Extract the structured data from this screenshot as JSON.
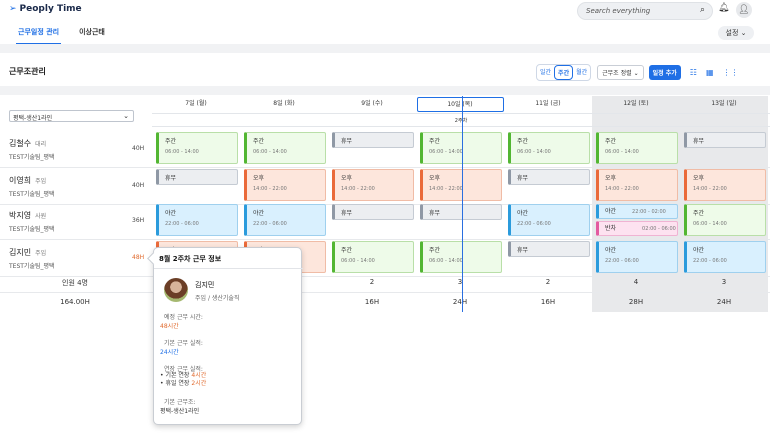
{
  "app": {
    "logo": "Peoply Time"
  },
  "nav": {
    "tabs": [
      "근무일정 관리",
      "이상근태"
    ],
    "active": 0
  },
  "search": {
    "placeholder": "Search everything"
  },
  "settings_label": "설정",
  "page_title": "근무조관리",
  "toolbar": {
    "view_modes": [
      "일간",
      "주간",
      "월간"
    ],
    "active_mode": "주간",
    "sort_label": "근무조 정렬",
    "add_label": "일정 추가"
  },
  "filter": {
    "location": "평택-생산1라인"
  },
  "days": [
    "7일 (월)",
    "8일 (화)",
    "9일 (수)",
    "10일 (목)",
    "11일 (금)",
    "12일 (토)",
    "13일 (일)"
  ],
  "today_index": 3,
  "week_label": "2주차",
  "employees": [
    {
      "name": "김철수",
      "rank": "대리",
      "dept": "TEST기술팀_평택",
      "hours": "40H",
      "warn": false
    },
    {
      "name": "이영희",
      "rank": "주임",
      "dept": "TEST기술팀_평택",
      "hours": "40H",
      "warn": false
    },
    {
      "name": "박지영",
      "rank": "사원",
      "dept": "TEST기술팀_평택",
      "hours": "36H",
      "warn": false
    },
    {
      "name": "김지민",
      "rank": "주임",
      "dept": "TEST기술팀_평택",
      "hours": "48H",
      "warn": true
    }
  ],
  "shifts": [
    [
      {
        "type": "day",
        "label": "주간",
        "time": "06:00 - 14:00"
      },
      {
        "type": "day",
        "label": "주간",
        "time": "06:00 - 14:00"
      },
      {
        "type": "off",
        "label": "휴무"
      },
      {
        "type": "day",
        "label": "주간",
        "time": "06:00 - 14:00"
      },
      {
        "type": "day",
        "label": "주간",
        "time": "06:00 - 14:00"
      },
      {
        "type": "day",
        "label": "주간",
        "time": "06:00 - 14:00"
      },
      {
        "type": "off",
        "label": "휴무"
      }
    ],
    [
      {
        "type": "off",
        "label": "휴무"
      },
      {
        "type": "eve",
        "label": "오후",
        "time": "14:00 - 22:00"
      },
      {
        "type": "eve",
        "label": "오후",
        "time": "14:00 - 22:00"
      },
      {
        "type": "eve",
        "label": "오후",
        "time": "14:00 - 22:00"
      },
      {
        "type": "off",
        "label": "휴무"
      },
      {
        "type": "eve",
        "label": "오후",
        "time": "14:00 - 22:00"
      },
      {
        "type": "eve",
        "label": "오후",
        "time": "14:00 - 22:00"
      }
    ],
    [
      {
        "type": "night",
        "label": "야간",
        "time": "22:00 - 06:00"
      },
      {
        "type": "night",
        "label": "야간",
        "time": "22:00 - 06:00"
      },
      {
        "type": "off",
        "label": "휴무"
      },
      {
        "type": "off",
        "label": "휴무"
      },
      {
        "type": "night",
        "label": "야간",
        "time": "22:00 - 06:00"
      },
      {
        "type": "split",
        "a_label": "야간",
        "a_time": "22:00 - 02:00",
        "b_label": "반차",
        "b_time": "02:00 - 06:00"
      },
      {
        "type": "day",
        "label": "주간",
        "time": "06:00 - 14:00"
      }
    ],
    [
      {
        "type": "eve",
        "label": "오후",
        "time": "14:00 - 22:00"
      },
      {
        "type": "eve",
        "label": "오후",
        "time": "14:00 - 22:00"
      },
      {
        "type": "day",
        "label": "주간",
        "time": "06:00 - 14:00"
      },
      {
        "type": "day",
        "label": "주간",
        "time": "06:00 - 14:00"
      },
      {
        "type": "off",
        "label": "휴무"
      },
      {
        "type": "night",
        "label": "야간",
        "time": "22:00 - 06:00"
      },
      {
        "type": "night",
        "label": "야간",
        "time": "22:00 - 06:00"
      }
    ]
  ],
  "summary": {
    "headcount_label": "인원 4명",
    "total_hours": "164.00H",
    "counts": [
      "",
      "",
      "2",
      "3",
      "2",
      "4",
      "3"
    ],
    "hours": [
      "",
      "",
      "16H",
      "24H",
      "16H",
      "28H",
      "24H"
    ]
  },
  "popover": {
    "title": "8월 2주차 근무 정보",
    "name": "김지민",
    "role": "주임 / 생산기술직",
    "planned_label": "예정 근무 시간:",
    "planned_value": "48시간",
    "basic_label": "기본 근무 실적:",
    "basic_value": "24시간",
    "ext_label": "연장 근무 실적:",
    "ext_items": [
      {
        "label": "기본 연장",
        "value": "4시간"
      },
      {
        "label": "휴일 연장",
        "value": "2시간"
      }
    ],
    "group_label": "기본 근무조:",
    "group_value": "평택-생산1라인"
  }
}
